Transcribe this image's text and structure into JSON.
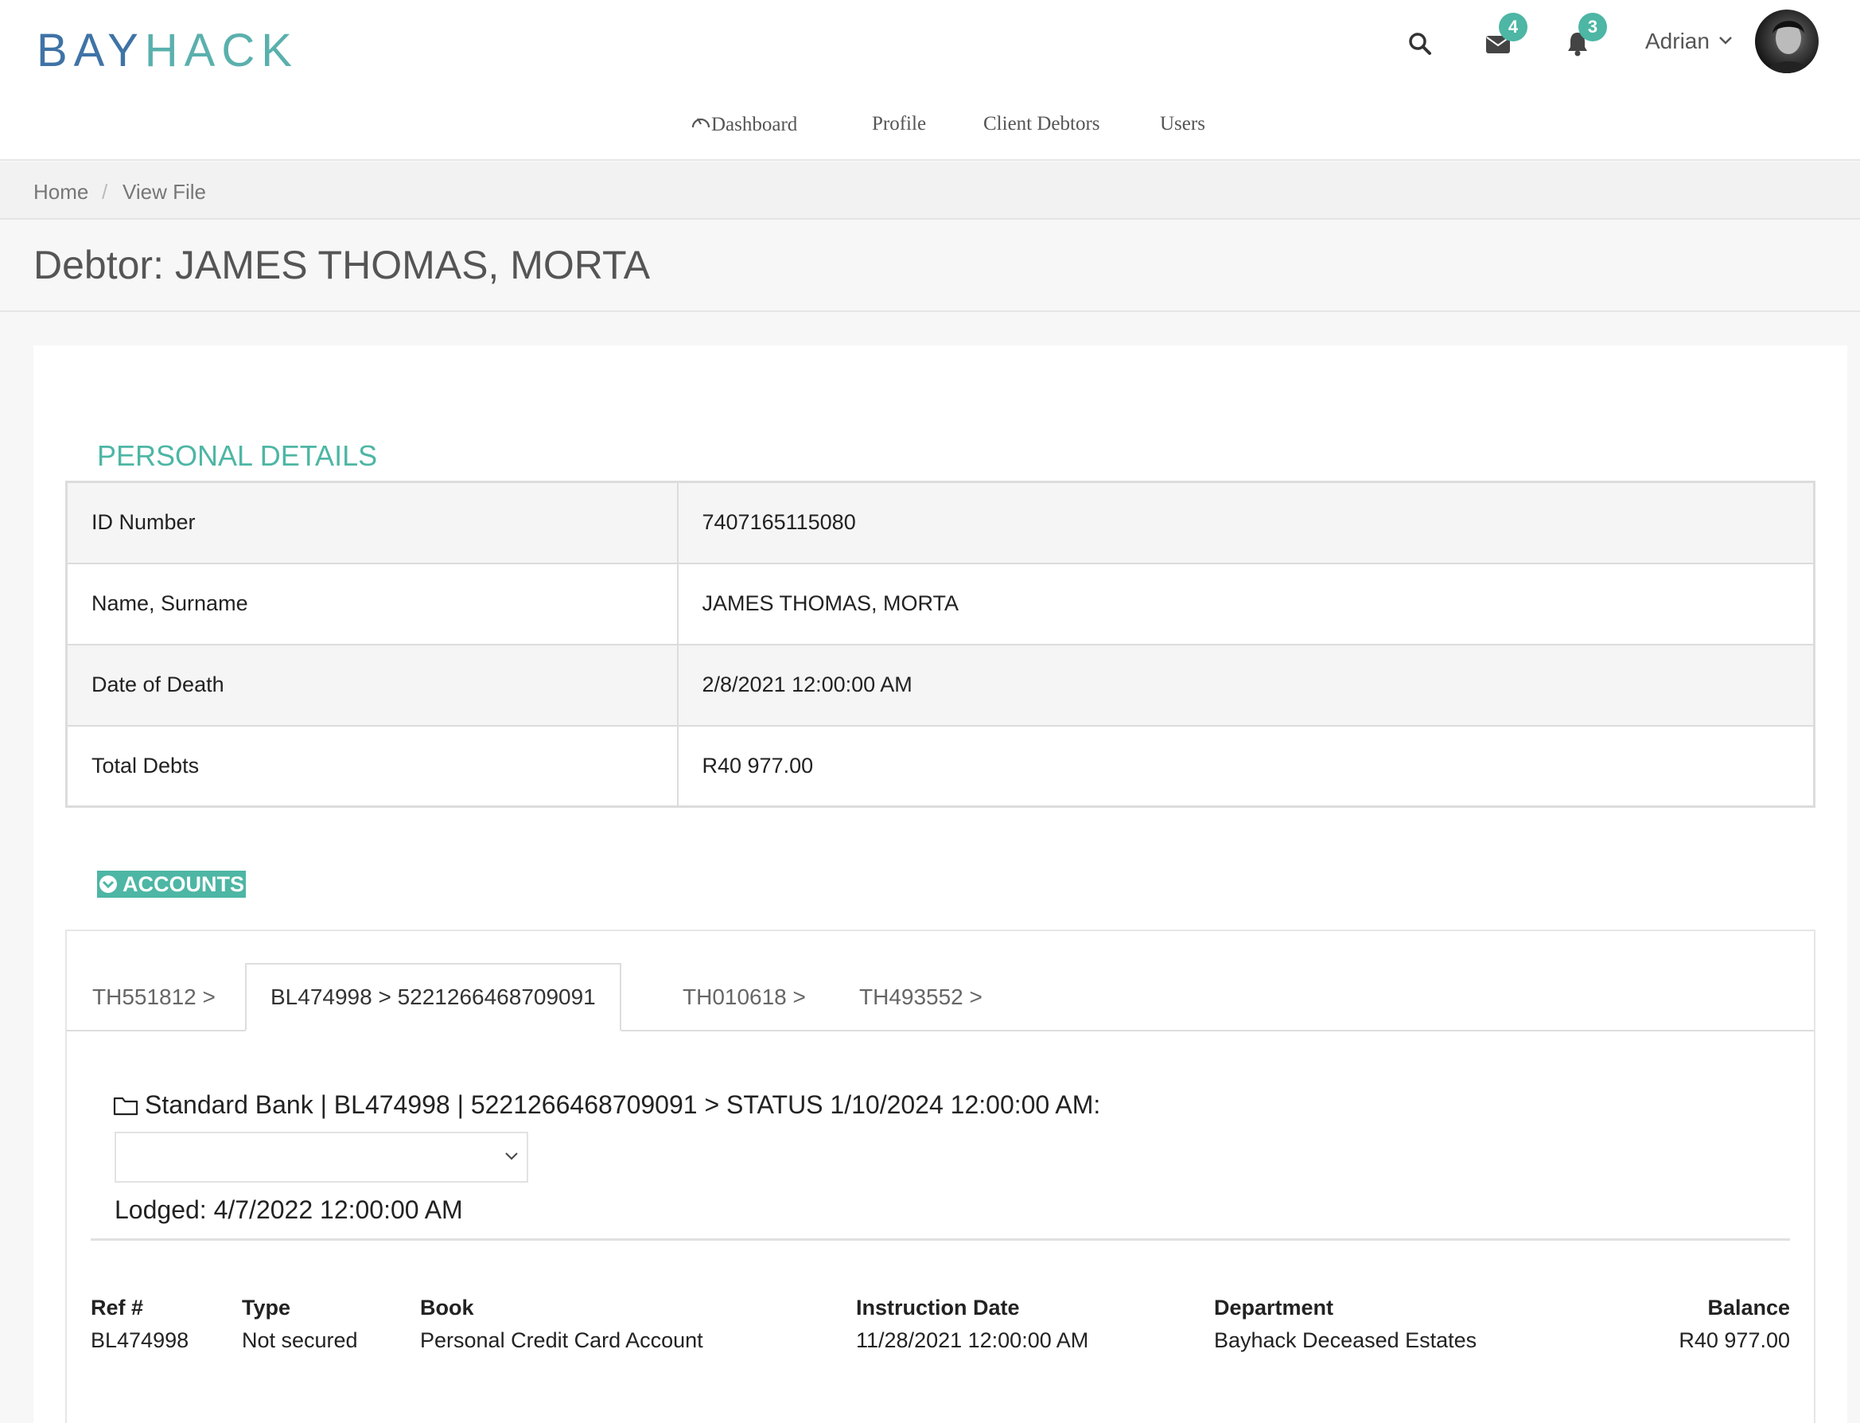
{
  "header": {
    "logo_part1": "BAY",
    "logo_part2": "HACK",
    "messages_badge": "4",
    "notifications_badge": "3",
    "user_name": "Adrian"
  },
  "nav": {
    "items": [
      "Dashboard",
      "Profile",
      "Client Debtors",
      "Users"
    ]
  },
  "breadcrumb": {
    "home": "Home",
    "separator": "/",
    "current": "View File"
  },
  "page": {
    "title": "Debtor: JAMES THOMAS, MORTA"
  },
  "personal_details": {
    "heading": "PERSONAL DETAILS",
    "rows": [
      {
        "label": "ID Number",
        "value": "7407165115080"
      },
      {
        "label": "Name, Surname",
        "value": "JAMES THOMAS, MORTA"
      },
      {
        "label": "Date of Death",
        "value": "2/8/2021 12:00:00 AM"
      },
      {
        "label": "Total Debts",
        "value": "R40 977.00"
      }
    ]
  },
  "accounts": {
    "heading": "ACCOUNTS",
    "tabs": [
      "TH551812 >",
      "BL474998 > 5221266468709091",
      "TH010618 >",
      "TH493552 >"
    ],
    "active_tab": 1,
    "account_line": "Standard Bank | BL474998 | 5221266468709091 > STATUS 1/10/2024 12:00:00 AM:",
    "status_select_value": "",
    "lodged": "Lodged: 4/7/2022 12:00:00 AM",
    "columns": {
      "ref": {
        "header": "Ref #",
        "value": "BL474998"
      },
      "type": {
        "header": "Type",
        "value": "Not secured"
      },
      "book": {
        "header": "Book",
        "value": "Personal Credit Card Account"
      },
      "instruction_date": {
        "header": "Instruction Date",
        "value": "11/28/2021 12:00:00 AM"
      },
      "department": {
        "header": "Department",
        "value": "Bayhack Deceased Estates"
      },
      "balance": {
        "header": "Balance",
        "value": "R40 977.00"
      }
    }
  },
  "colors": {
    "accent": "#4db6a4",
    "logo_blue": "#3f73a6",
    "logo_teal": "#5ab0ad"
  }
}
